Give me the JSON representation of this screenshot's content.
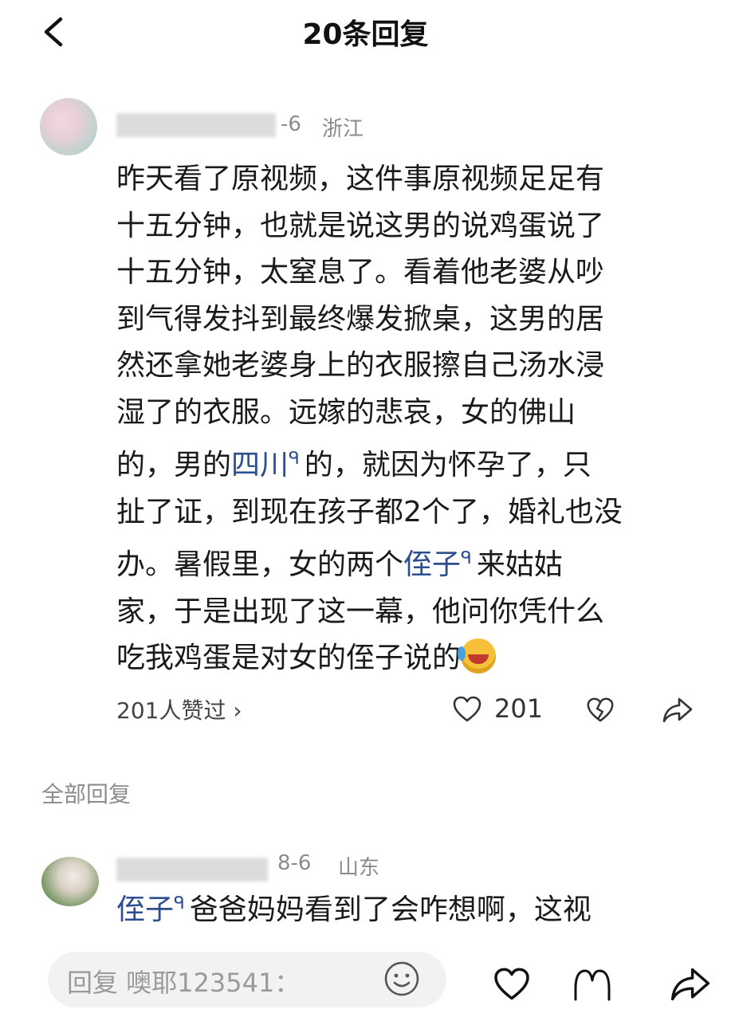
{
  "header": {
    "title": "20条回复"
  },
  "comment": {
    "date": "-6",
    "location": "浙江",
    "lines": [
      {
        "parts": [
          {
            "text": "昨天看了原视频，这件事原视频足足有"
          }
        ]
      },
      {
        "parts": [
          {
            "text": "十五分钟，也就是说这男的说鸡蛋说了"
          }
        ]
      },
      {
        "parts": [
          {
            "text": "十五分钟，太窒息了。看着他老婆从吵"
          }
        ]
      },
      {
        "parts": [
          {
            "text": "到气得发抖到最终爆发掀桌，这男的居"
          }
        ]
      },
      {
        "parts": [
          {
            "text": "然还拿她老婆身上的衣服擦自己汤水浸"
          }
        ]
      },
      {
        "parts": [
          {
            "text": "湿了的衣服。远嫁的悲哀，女的佛山"
          }
        ]
      },
      {
        "parts": [
          {
            "text": "的，男的"
          },
          {
            "text": "四川",
            "link": true
          },
          {
            "text": "的，就因为怀孕了，只"
          }
        ]
      },
      {
        "parts": [
          {
            "text": "扯了证，到现在孩子都2个了，婚礼也没"
          }
        ]
      },
      {
        "parts": [
          {
            "text": "办。暑假里，女的两个"
          },
          {
            "text": "侄子",
            "link": true
          },
          {
            "text": "来姑姑"
          }
        ]
      },
      {
        "parts": [
          {
            "text": "家，于是出现了这一幕，他问你凭什么"
          }
        ]
      },
      {
        "parts": [
          {
            "text": "吃我鸡蛋是对女的侄子说的"
          },
          {
            "emoji": true
          }
        ]
      }
    ],
    "likes_summary": "201人赞过 ›",
    "like_count": "201"
  },
  "section": {
    "all_replies_label": "全部回复"
  },
  "reply": {
    "date": "8-6",
    "location": "山东",
    "link_text": "侄子",
    "text": "爸爸妈妈看到了会咋想啊，这视"
  },
  "bottom_bar": {
    "input_placeholder": "回复 噢耶123541："
  },
  "icons": {
    "back": "chevron-left-icon",
    "like": "heart-icon",
    "dislike": "broken-heart-icon",
    "share": "share-arrow-icon",
    "emoji": "smiley-icon",
    "search_link": "search-icon"
  }
}
